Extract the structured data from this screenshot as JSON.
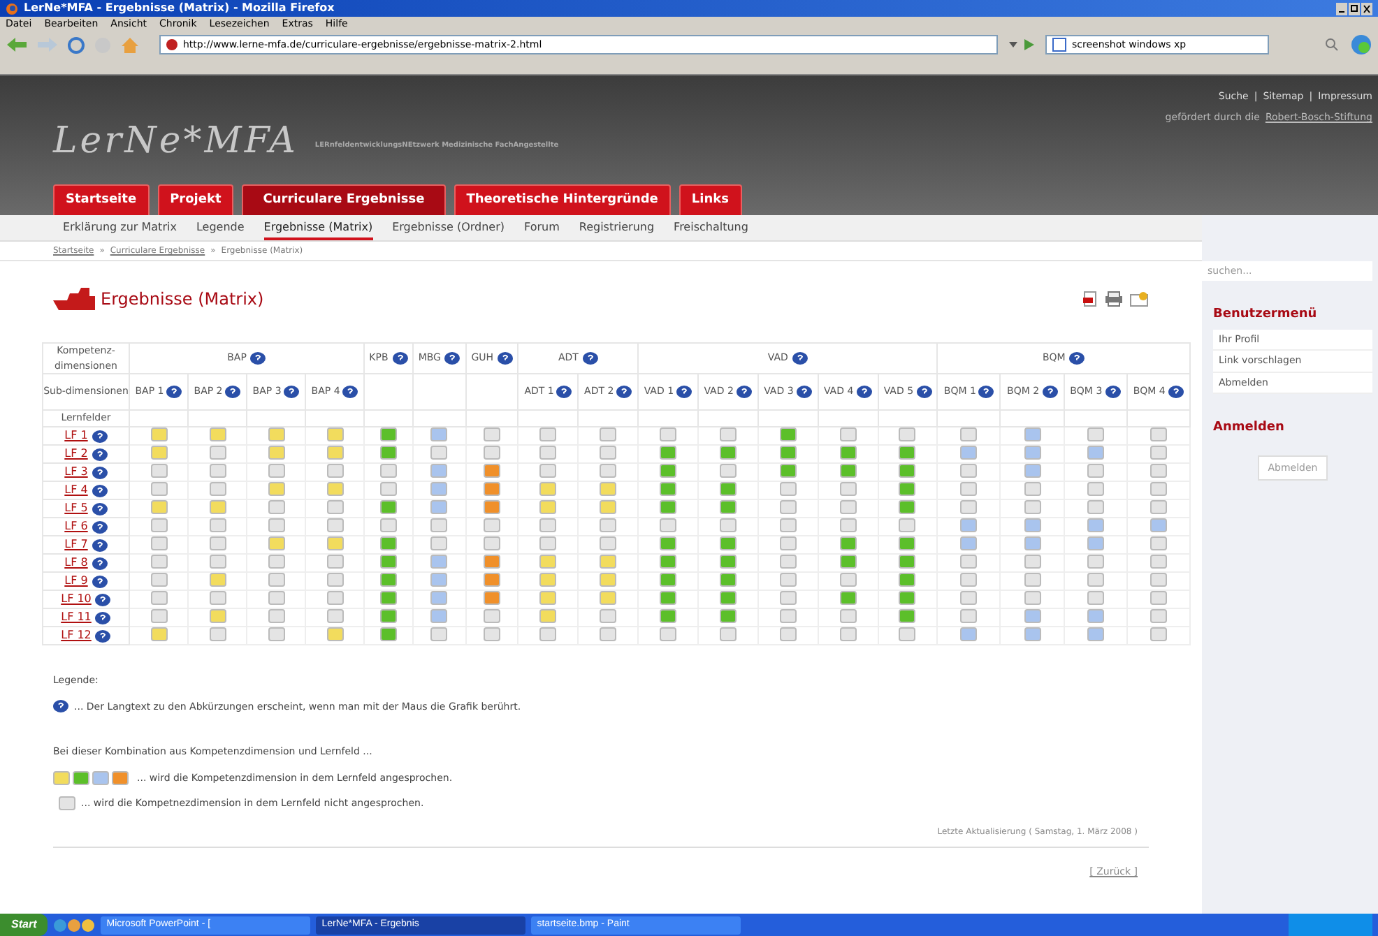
{
  "browser": {
    "title": "LerNe*MFA - Ergebnisse (Matrix) - Mozilla Firefox",
    "menu": [
      "Datei",
      "Bearbeiten",
      "Ansicht",
      "Chronik",
      "Lesezeichen",
      "Extras",
      "Hilfe"
    ],
    "url": "http://www.lerne-mfa.de/curriculare-ergebnisse/ergebnisse-matrix-2.html",
    "search_value": "screenshot windows xp"
  },
  "site": {
    "logo": "LerNe*MFA",
    "tagline": "LERnfeldentwicklungsNEtzwerk Medizinische FachAngestellte",
    "separator": "|",
    "top_links": [
      "Suche",
      "Sitemap",
      "Impressum"
    ],
    "funding_text": "gefördert durch die",
    "funding_link": "Robert-Bosch-Stiftung",
    "tabs": [
      {
        "label": "Startseite",
        "selected": false
      },
      {
        "label": "Projekt",
        "selected": false
      },
      {
        "label": "Curriculare Ergebnisse",
        "selected": true
      },
      {
        "label": "Theoretische Hintergründe",
        "selected": false
      },
      {
        "label": "Links",
        "selected": false
      }
    ],
    "subnav": [
      {
        "label": "Erklärung zur Matrix",
        "selected": false
      },
      {
        "label": "Legende",
        "selected": false
      },
      {
        "label": "Ergebnisse (Matrix)",
        "selected": true
      },
      {
        "label": "Ergebnisse (Ordner)",
        "selected": false
      },
      {
        "label": "Forum",
        "selected": false
      },
      {
        "label": "Registrierung",
        "selected": false
      },
      {
        "label": "Freischaltung",
        "selected": false
      }
    ],
    "breadcrumb_separator": "»",
    "breadcrumb": [
      "Startseite",
      "Curriculare Ergebnisse",
      "Ergebnisse (Matrix)"
    ],
    "search_placeholder": "suchen..."
  },
  "page_title": "Ergebnisse (Matrix)",
  "matrix": {
    "corner_labels": [
      "Kompetenz-dimensionen",
      "Sub-dimensionen",
      "Lernfelder"
    ],
    "groups": [
      {
        "label": "BAP",
        "columns": [
          "BAP 1",
          "BAP 2",
          "BAP 3",
          "BAP 4"
        ]
      },
      {
        "label": "KPB"
      },
      {
        "label": "MBG"
      },
      {
        "label": "GUH"
      },
      {
        "label": "ADT",
        "columns": [
          "ADT 1",
          "ADT 2"
        ]
      },
      {
        "label": "VAD",
        "columns": [
          "VAD 1",
          "VAD 2",
          "VAD 3",
          "VAD 4",
          "VAD 5"
        ]
      },
      {
        "label": "BQM",
        "columns": [
          "BQM 1",
          "BQM 2",
          "BQM 3",
          "BQM 4"
        ]
      }
    ],
    "rows": [
      {
        "label": "LF 1",
        "cells": [
          {
            "color": "#f2dc5d"
          },
          {
            "color": "#f2dc5d"
          },
          {
            "color": "#f2dc5d"
          },
          {
            "color": "#f2dc5d"
          },
          {
            "color": "#5cbf2a"
          },
          {
            "color": "#a9c4ee"
          },
          {
            "color": "#e4e4e4"
          },
          {
            "color": "#e4e4e4"
          },
          {
            "color": "#e4e4e4"
          },
          {
            "color": "#e4e4e4"
          },
          {
            "color": "#e4e4e4"
          },
          {
            "color": "#5cbf2a"
          },
          {
            "color": "#e4e4e4"
          },
          {
            "color": "#e4e4e4"
          },
          {
            "color": "#e4e4e4"
          },
          {
            "color": "#a9c4ee"
          },
          {
            "color": "#e4e4e4"
          },
          {
            "color": "#e4e4e4"
          }
        ]
      },
      {
        "label": "LF 2",
        "cells": [
          {
            "color": "#f2dc5d"
          },
          {
            "color": "#e4e4e4"
          },
          {
            "color": "#f2dc5d"
          },
          {
            "color": "#f2dc5d"
          },
          {
            "color": "#5cbf2a"
          },
          {
            "color": "#e4e4e4"
          },
          {
            "color": "#e4e4e4"
          },
          {
            "color": "#e4e4e4"
          },
          {
            "color": "#e4e4e4"
          },
          {
            "color": "#5cbf2a"
          },
          {
            "color": "#5cbf2a"
          },
          {
            "color": "#5cbf2a"
          },
          {
            "color": "#5cbf2a"
          },
          {
            "color": "#5cbf2a"
          },
          {
            "color": "#a9c4ee"
          },
          {
            "color": "#a9c4ee"
          },
          {
            "color": "#a9c4ee"
          },
          {
            "color": "#e4e4e4"
          }
        ]
      },
      {
        "label": "LF 3",
        "cells": [
          {
            "color": "#e4e4e4"
          },
          {
            "color": "#e4e4e4"
          },
          {
            "color": "#e4e4e4"
          },
          {
            "color": "#e4e4e4"
          },
          {
            "color": "#e4e4e4"
          },
          {
            "color": "#a9c4ee"
          },
          {
            "color": "#f0902a"
          },
          {
            "color": "#e4e4e4"
          },
          {
            "color": "#e4e4e4"
          },
          {
            "color": "#5cbf2a"
          },
          {
            "color": "#e4e4e4"
          },
          {
            "color": "#5cbf2a"
          },
          {
            "color": "#5cbf2a"
          },
          {
            "color": "#5cbf2a"
          },
          {
            "color": "#e4e4e4"
          },
          {
            "color": "#a9c4ee"
          },
          {
            "color": "#e4e4e4"
          },
          {
            "color": "#e4e4e4"
          }
        ]
      },
      {
        "label": "LF 4",
        "cells": [
          {
            "color": "#e4e4e4"
          },
          {
            "color": "#e4e4e4"
          },
          {
            "color": "#f2dc5d"
          },
          {
            "color": "#f2dc5d"
          },
          {
            "color": "#e4e4e4"
          },
          {
            "color": "#a9c4ee"
          },
          {
            "color": "#f0902a"
          },
          {
            "color": "#f2dc5d"
          },
          {
            "color": "#f2dc5d"
          },
          {
            "color": "#5cbf2a"
          },
          {
            "color": "#5cbf2a"
          },
          {
            "color": "#e4e4e4"
          },
          {
            "color": "#e4e4e4"
          },
          {
            "color": "#5cbf2a"
          },
          {
            "color": "#e4e4e4"
          },
          {
            "color": "#e4e4e4"
          },
          {
            "color": "#e4e4e4"
          },
          {
            "color": "#e4e4e4"
          }
        ]
      },
      {
        "label": "LF 5",
        "cells": [
          {
            "color": "#f2dc5d"
          },
          {
            "color": "#f2dc5d"
          },
          {
            "color": "#e4e4e4"
          },
          {
            "color": "#e4e4e4"
          },
          {
            "color": "#5cbf2a"
          },
          {
            "color": "#a9c4ee"
          },
          {
            "color": "#f0902a"
          },
          {
            "color": "#f2dc5d"
          },
          {
            "color": "#f2dc5d"
          },
          {
            "color": "#5cbf2a"
          },
          {
            "color": "#5cbf2a"
          },
          {
            "color": "#e4e4e4"
          },
          {
            "color": "#e4e4e4"
          },
          {
            "color": "#5cbf2a"
          },
          {
            "color": "#e4e4e4"
          },
          {
            "color": "#e4e4e4"
          },
          {
            "color": "#e4e4e4"
          },
          {
            "color": "#e4e4e4"
          }
        ]
      },
      {
        "label": "LF 6",
        "cells": [
          {
            "color": "#e4e4e4"
          },
          {
            "color": "#e4e4e4"
          },
          {
            "color": "#e4e4e4"
          },
          {
            "color": "#e4e4e4"
          },
          {
            "color": "#e4e4e4"
          },
          {
            "color": "#e4e4e4"
          },
          {
            "color": "#e4e4e4"
          },
          {
            "color": "#e4e4e4"
          },
          {
            "color": "#e4e4e4"
          },
          {
            "color": "#e4e4e4"
          },
          {
            "color": "#e4e4e4"
          },
          {
            "color": "#e4e4e4"
          },
          {
            "color": "#e4e4e4"
          },
          {
            "color": "#e4e4e4"
          },
          {
            "color": "#a9c4ee"
          },
          {
            "color": "#a9c4ee"
          },
          {
            "color": "#a9c4ee"
          },
          {
            "color": "#a9c4ee"
          }
        ]
      },
      {
        "label": "LF 7",
        "cells": [
          {
            "color": "#e4e4e4"
          },
          {
            "color": "#e4e4e4"
          },
          {
            "color": "#f2dc5d"
          },
          {
            "color": "#f2dc5d"
          },
          {
            "color": "#5cbf2a"
          },
          {
            "color": "#e4e4e4"
          },
          {
            "color": "#e4e4e4"
          },
          {
            "color": "#e4e4e4"
          },
          {
            "color": "#e4e4e4"
          },
          {
            "color": "#5cbf2a"
          },
          {
            "color": "#5cbf2a"
          },
          {
            "color": "#e4e4e4"
          },
          {
            "color": "#5cbf2a"
          },
          {
            "color": "#5cbf2a"
          },
          {
            "color": "#a9c4ee"
          },
          {
            "color": "#a9c4ee"
          },
          {
            "color": "#a9c4ee"
          },
          {
            "color": "#e4e4e4"
          }
        ]
      },
      {
        "label": "LF 8",
        "cells": [
          {
            "color": "#e4e4e4"
          },
          {
            "color": "#e4e4e4"
          },
          {
            "color": "#e4e4e4"
          },
          {
            "color": "#e4e4e4"
          },
          {
            "color": "#5cbf2a"
          },
          {
            "color": "#a9c4ee"
          },
          {
            "color": "#f0902a"
          },
          {
            "color": "#f2dc5d"
          },
          {
            "color": "#f2dc5d"
          },
          {
            "color": "#5cbf2a"
          },
          {
            "color": "#5cbf2a"
          },
          {
            "color": "#e4e4e4"
          },
          {
            "color": "#5cbf2a"
          },
          {
            "color": "#5cbf2a"
          },
          {
            "color": "#e4e4e4"
          },
          {
            "color": "#e4e4e4"
          },
          {
            "color": "#e4e4e4"
          },
          {
            "color": "#e4e4e4"
          }
        ]
      },
      {
        "label": "LF 9",
        "cells": [
          {
            "color": "#e4e4e4"
          },
          {
            "color": "#f2dc5d"
          },
          {
            "color": "#e4e4e4"
          },
          {
            "color": "#e4e4e4"
          },
          {
            "color": "#5cbf2a"
          },
          {
            "color": "#a9c4ee"
          },
          {
            "color": "#f0902a"
          },
          {
            "color": "#f2dc5d"
          },
          {
            "color": "#f2dc5d"
          },
          {
            "color": "#5cbf2a"
          },
          {
            "color": "#5cbf2a"
          },
          {
            "color": "#e4e4e4"
          },
          {
            "color": "#e4e4e4"
          },
          {
            "color": "#5cbf2a"
          },
          {
            "color": "#e4e4e4"
          },
          {
            "color": "#e4e4e4"
          },
          {
            "color": "#e4e4e4"
          },
          {
            "color": "#e4e4e4"
          }
        ]
      },
      {
        "label": "LF 10",
        "cells": [
          {
            "color": "#e4e4e4"
          },
          {
            "color": "#e4e4e4"
          },
          {
            "color": "#e4e4e4"
          },
          {
            "color": "#e4e4e4"
          },
          {
            "color": "#5cbf2a"
          },
          {
            "color": "#a9c4ee"
          },
          {
            "color": "#f0902a"
          },
          {
            "color": "#f2dc5d"
          },
          {
            "color": "#f2dc5d"
          },
          {
            "color": "#5cbf2a"
          },
          {
            "color": "#5cbf2a"
          },
          {
            "color": "#e4e4e4"
          },
          {
            "color": "#5cbf2a"
          },
          {
            "color": "#5cbf2a"
          },
          {
            "color": "#e4e4e4"
          },
          {
            "color": "#e4e4e4"
          },
          {
            "color": "#e4e4e4"
          },
          {
            "color": "#e4e4e4"
          }
        ]
      },
      {
        "label": "LF 11",
        "cells": [
          {
            "color": "#e4e4e4"
          },
          {
            "color": "#f2dc5d"
          },
          {
            "color": "#e4e4e4"
          },
          {
            "color": "#e4e4e4"
          },
          {
            "color": "#5cbf2a"
          },
          {
            "color": "#a9c4ee"
          },
          {
            "color": "#e4e4e4"
          },
          {
            "color": "#f2dc5d"
          },
          {
            "color": "#e4e4e4"
          },
          {
            "color": "#5cbf2a"
          },
          {
            "color": "#5cbf2a"
          },
          {
            "color": "#e4e4e4"
          },
          {
            "color": "#e4e4e4"
          },
          {
            "color": "#5cbf2a"
          },
          {
            "color": "#e4e4e4"
          },
          {
            "color": "#a9c4ee"
          },
          {
            "color": "#a9c4ee"
          },
          {
            "color": "#e4e4e4"
          }
        ]
      },
      {
        "label": "LF 12",
        "cells": [
          {
            "color": "#f2dc5d"
          },
          {
            "color": "#e4e4e4"
          },
          {
            "color": "#e4e4e4"
          },
          {
            "color": "#f2dc5d"
          },
          {
            "color": "#5cbf2a"
          },
          {
            "color": "#e4e4e4"
          },
          {
            "color": "#e4e4e4"
          },
          {
            "color": "#e4e4e4"
          },
          {
            "color": "#e4e4e4"
          },
          {
            "color": "#e4e4e4"
          },
          {
            "color": "#e4e4e4"
          },
          {
            "color": "#e4e4e4"
          },
          {
            "color": "#e4e4e4"
          },
          {
            "color": "#e4e4e4"
          },
          {
            "color": "#a9c4ee"
          },
          {
            "color": "#a9c4ee"
          },
          {
            "color": "#a9c4ee"
          },
          {
            "color": "#e4e4e4"
          }
        ]
      }
    ]
  },
  "legend": {
    "title": "Legende:",
    "help_text": "... Der Langtext zu den Abkürzungen erscheint, wenn man mit der Maus die Grafik berührt.",
    "intro": "Bei dieser Kombination aus Kompetenzdimension und Lernfeld ...",
    "active_swatches": [
      {
        "color": "#f2dc5d"
      },
      {
        "color": "#5cbf2a"
      },
      {
        "color": "#a9c4ee"
      },
      {
        "color": "#f0902a"
      }
    ],
    "active_text": "... wird die Kompetenzdimension in dem Lernfeld angesprochen.",
    "inactive_swatch": {
      "color": "#e4e4e4"
    },
    "inactive_text": "... wird die Kompetnezdimension in dem Lernfeld nicht angesprochen."
  },
  "last_update": "Letzte Aktualisierung ( Samstag, 1. März 2008 )",
  "back_link": "[ Zurück ]",
  "sidebar": {
    "menu_title": "Benutzermenü",
    "menu_items": [
      "Ihr Profil",
      "Link vorschlagen",
      "Abmelden"
    ],
    "login_title": "Anmelden",
    "login_button": "Abmelden"
  },
  "taskbar": {
    "start": "Start",
    "items": [
      {
        "label": "Microsoft PowerPoint - [",
        "selected": false
      },
      {
        "label": "LerNe*MFA - Ergebnis",
        "selected": true
      },
      {
        "label": "startseite.bmp - Paint",
        "selected": false
      }
    ]
  }
}
